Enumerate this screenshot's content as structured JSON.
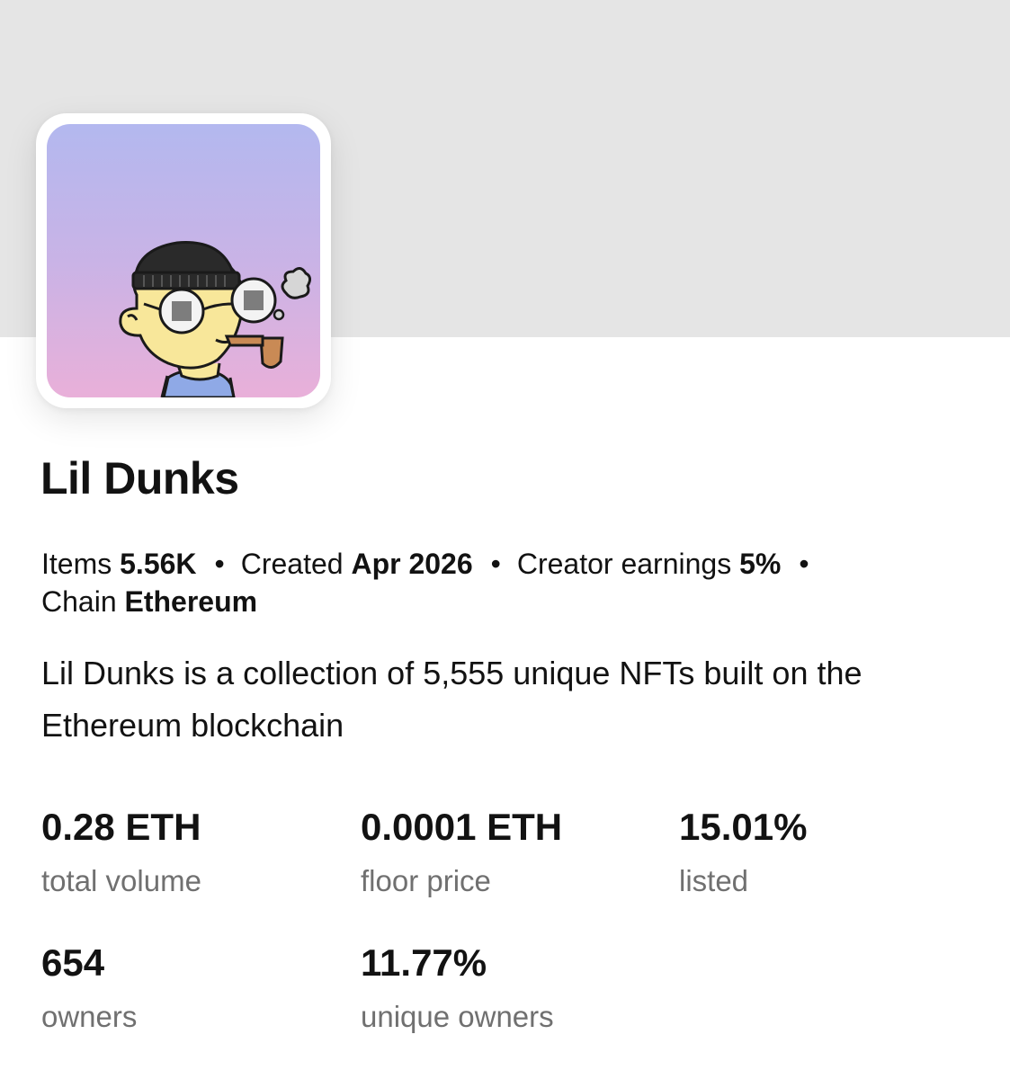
{
  "collection": {
    "name": "Lil Dunks",
    "meta": {
      "items_label": "Items",
      "items_value": "5.56K",
      "created_label": "Created",
      "created_value": "Apr 2026",
      "earnings_label": "Creator earnings",
      "earnings_value": "5%",
      "chain_label": "Chain",
      "chain_value": "Ethereum",
      "separator": "•"
    },
    "description": "Lil Dunks is a collection of 5,555 unique NFTs built on the Ethereum blockchain"
  },
  "stats": [
    {
      "value": "0.28 ETH",
      "label": "total volume"
    },
    {
      "value": "0.0001 ETH",
      "label": "floor price"
    },
    {
      "value": "15.01%",
      "label": "listed"
    },
    {
      "value": "654",
      "label": "owners"
    },
    {
      "value": "11.77%",
      "label": "unique owners"
    }
  ],
  "colors": {
    "banner": "#e5e5e5",
    "text_primary": "#121212",
    "text_secondary": "#707070",
    "avatar_gradient_top": "#b3b8ef",
    "avatar_gradient_bottom": "#e9b0d9"
  }
}
